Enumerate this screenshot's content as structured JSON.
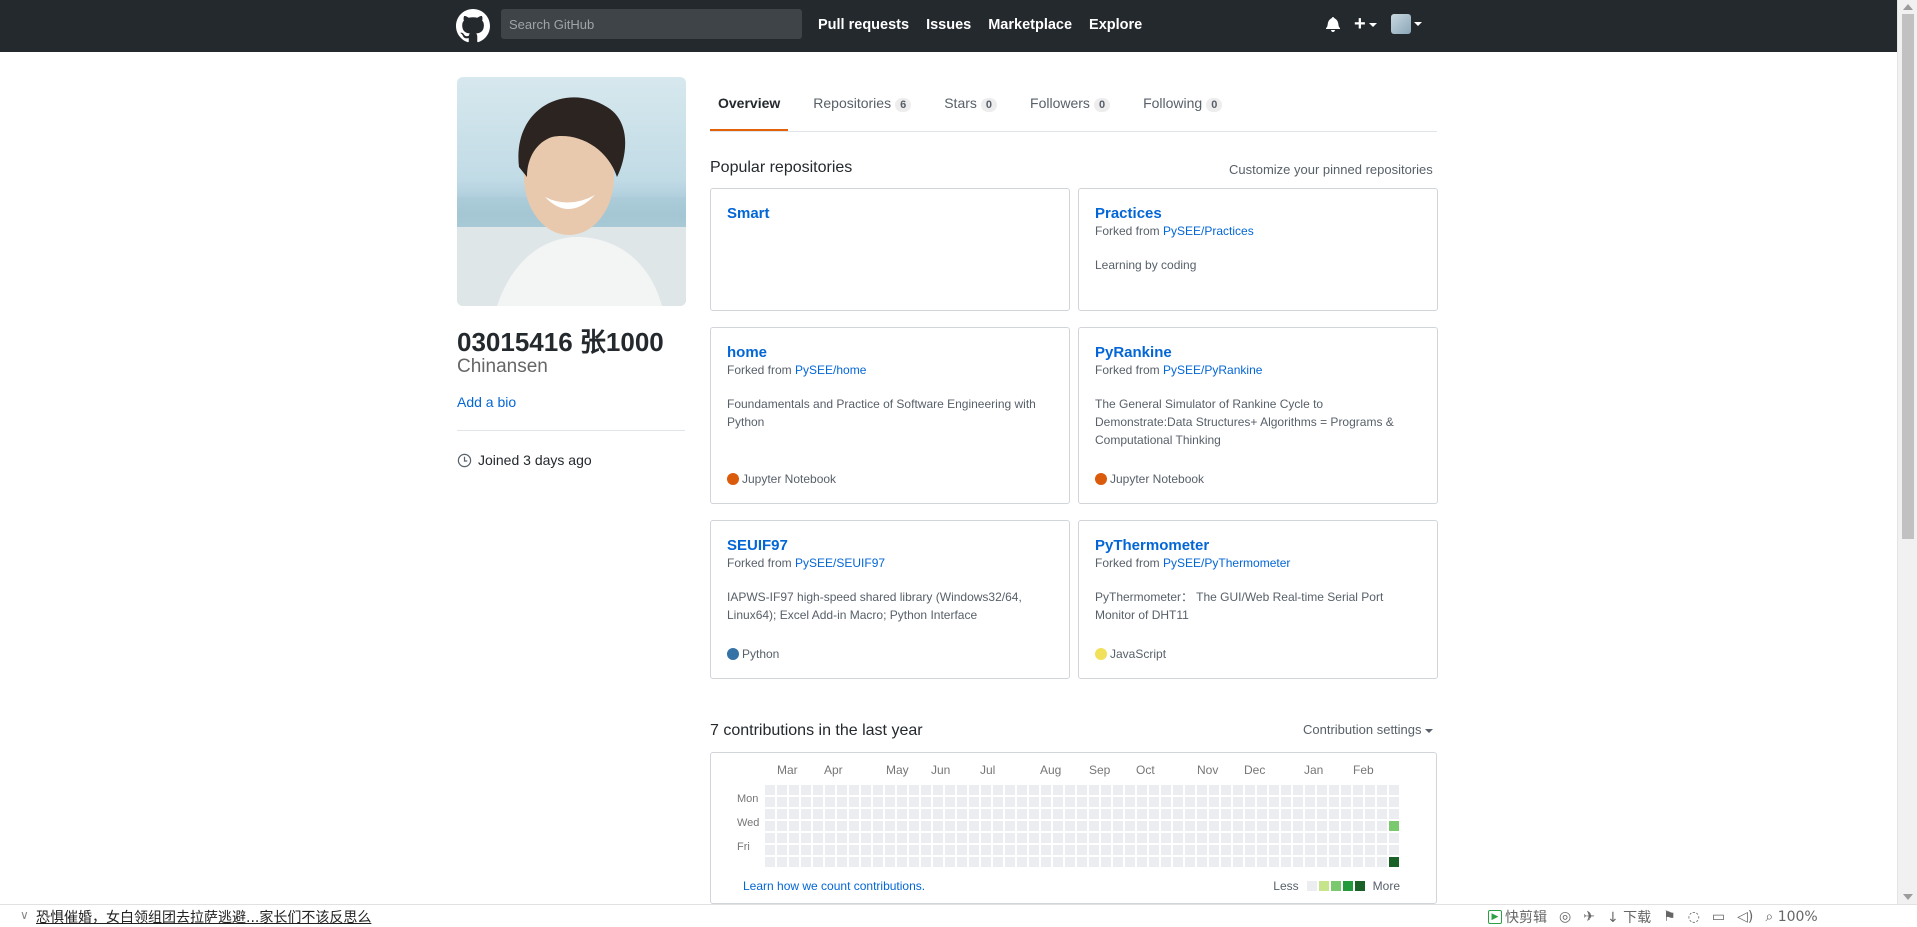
{
  "header": {
    "search_placeholder": "Search GitHub",
    "nav": [
      "Pull requests",
      "Issues",
      "Marketplace",
      "Explore"
    ]
  },
  "profile": {
    "name": "03015416 张1000",
    "login": "Chinansen",
    "add_bio": "Add a bio",
    "joined": "Joined 3 days ago"
  },
  "tabs": [
    {
      "label": "Overview",
      "count": null,
      "selected": true
    },
    {
      "label": "Repositories",
      "count": "6"
    },
    {
      "label": "Stars",
      "count": "0"
    },
    {
      "label": "Followers",
      "count": "0"
    },
    {
      "label": "Following",
      "count": "0"
    }
  ],
  "pinned": {
    "title": "Popular repositories",
    "customize": "Customize your pinned repositories",
    "forked_prefix": "Forked from",
    "repos": [
      {
        "name": "Smart",
        "fork": "",
        "desc": "",
        "lang": "",
        "lang_color": ""
      },
      {
        "name": "Practices",
        "fork": "PySEE/Practices",
        "desc": "Learning by coding",
        "lang": "",
        "lang_color": ""
      },
      {
        "name": "home",
        "fork": "PySEE/home",
        "desc": "Foundamentals and Practice of Software Engineering with Python",
        "lang": "Jupyter Notebook",
        "lang_color": "#DA5B0B"
      },
      {
        "name": "PyRankine",
        "fork": "PySEE/PyRankine",
        "desc": "The General Simulator of Rankine Cycle to Demonstrate:Data Structures+ Algorithms = Programs & Computational Thinking",
        "lang": "Jupyter Notebook",
        "lang_color": "#DA5B0B"
      },
      {
        "name": "SEUIF97",
        "fork": "PySEE/SEUIF97",
        "desc": "IAPWS-IF97 high-speed shared library (Windows32/64, Linux64); Excel Add-in Macro; Python Interface",
        "lang": "Python",
        "lang_color": "#3572A5"
      },
      {
        "name": "PyThermometer",
        "fork": "PySEE/PyThermometer",
        "desc": "PyThermometer： The GUI/Web Real-time Serial Port Monitor of DHT11",
        "lang": "JavaScript",
        "lang_color": "#f1e05a"
      }
    ]
  },
  "contributions": {
    "title": "7 contributions in the last year",
    "settings": "Contribution settings",
    "months": [
      "Mar",
      "Apr",
      "May",
      "Jun",
      "Jul",
      "Aug",
      "Sep",
      "Oct",
      "Nov",
      "Dec",
      "Jan",
      "Feb"
    ],
    "days": [
      "Mon",
      "Wed",
      "Fri"
    ],
    "learn": "Learn how we count contributions.",
    "less": "Less",
    "more": "More",
    "colors": [
      "#ebedf0",
      "#c6e48b",
      "#7bc96f",
      "#239a3b",
      "#196127"
    ],
    "weeks": 53,
    "active_cells": [
      {
        "week": 52,
        "day": 3,
        "level": 2
      },
      {
        "week": 52,
        "day": 6,
        "level": 4
      }
    ]
  },
  "browser_bar": {
    "news": "恐惧催婚，女白领组团去拉萨逃避...家长们不该反思么",
    "kuaijianji": "快剪辑",
    "download": "下载",
    "zoom": "100%"
  }
}
